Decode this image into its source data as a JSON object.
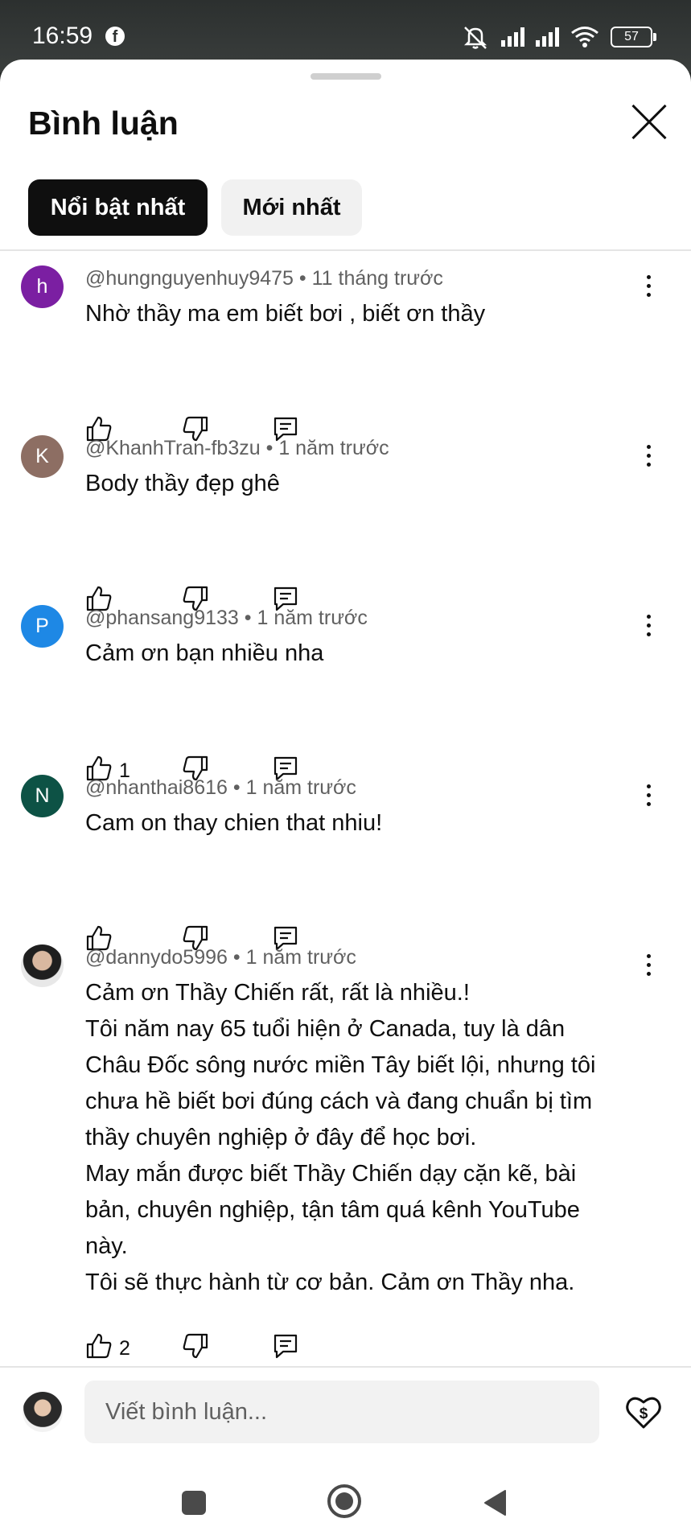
{
  "status": {
    "time": "16:59",
    "battery": "57"
  },
  "sheet": {
    "title": "Bình luận"
  },
  "sort": {
    "top": "Nổi bật nhất",
    "newest": "Mới nhất"
  },
  "comments": [
    {
      "avatar": "h",
      "avatar_color": "#7b1fa2",
      "handle": "@hungnguyenhuy9475",
      "time": "11 tháng trước",
      "text": "Nhờ thầy ma em biết bơi , biết ơn thầy",
      "likes": ""
    },
    {
      "avatar": "K",
      "avatar_color": "#8d6e63",
      "handle": "@KhanhTran-fb3zu",
      "time": "1 năm trước",
      "text": "Body thầy đẹp ghê",
      "likes": ""
    },
    {
      "avatar": "P",
      "avatar_color": "#1e88e5",
      "handle": "@phansang9133",
      "time": "1 năm trước",
      "text": "Cảm ơn bạn nhiều nha",
      "likes": "1"
    },
    {
      "avatar": "N",
      "avatar_color": "#0d5245",
      "handle": "@nhanthai8616",
      "time": "1 năm trước",
      "text": "Cam on thay chien that nhiu!",
      "likes": ""
    },
    {
      "avatar": "",
      "avatar_color": "",
      "handle": "@dannydo5996",
      "time": "1 năm trước",
      "lines": [
        "Cảm ơn Thầy Chiến rất, rất là nhiều.!",
        "Tôi năm nay 65 tuổi hiện ở Canada, tuy là dân",
        "Châu Đốc sông nước miền Tây biết lội, nhưng tôi",
        "chưa hề biết bơi đúng cách và đang chuẩn bị tìm",
        "thầy chuyên nghiệp ở đây để học bơi.",
        "May mắn được biết Thầy Chiến dạy cặn kẽ, bài",
        "bản, chuyên nghiệp, tận tâm quá kênh YouTube",
        "này.",
        "Tôi sẽ thực hành từ cơ bản. Cảm ơn Thầy nha."
      ],
      "likes": "2"
    }
  ],
  "separator": "•",
  "composer": {
    "placeholder": "Viết bình luận..."
  }
}
